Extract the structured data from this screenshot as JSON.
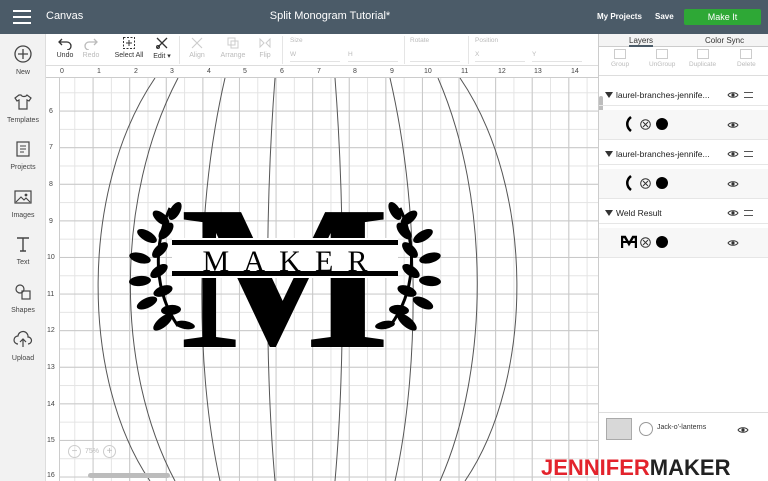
{
  "topbar": {
    "app_title": "Canvas",
    "doc_title": "Split Monogram Tutorial*",
    "projects": "My Projects",
    "save": "Save",
    "make_it": "Make It"
  },
  "sidebar": {
    "items": [
      {
        "label": "New",
        "icon": "plus-circle-icon"
      },
      {
        "label": "Templates",
        "icon": "shirt-icon"
      },
      {
        "label": "Projects",
        "icon": "projects-icon"
      },
      {
        "label": "Images",
        "icon": "image-icon"
      },
      {
        "label": "Text",
        "icon": "text-icon"
      },
      {
        "label": "Shapes",
        "icon": "shapes-icon"
      },
      {
        "label": "Upload",
        "icon": "upload-icon"
      }
    ]
  },
  "toolbar": {
    "undo": "Undo",
    "redo": "Redo",
    "select_all": "Select All",
    "edit": "Edit",
    "align": "Align",
    "arrange": "Arrange",
    "flip": "Flip",
    "size_label": "Size",
    "w": "W",
    "h": "H",
    "rotate_label": "Rotate",
    "position_label": "Position",
    "x": "X",
    "y": "Y"
  },
  "ruler": {
    "top": [
      "0",
      "1",
      "2",
      "3",
      "4",
      "5",
      "6",
      "7",
      "8",
      "9",
      "10",
      "11",
      "12",
      "13",
      "14"
    ],
    "left": [
      "6",
      "7",
      "8",
      "9",
      "10",
      "11",
      "12",
      "13",
      "14",
      "15",
      "16"
    ]
  },
  "canvas": {
    "zoom": "75%",
    "monogram_letter": "M",
    "monogram_word": "MAKER"
  },
  "panel": {
    "tabs": [
      "Layers",
      "Color Sync"
    ],
    "actions": [
      "Group",
      "UnGroup",
      "Duplicate",
      "Delete"
    ],
    "layers": [
      {
        "name": "laurel-branches-jennife..."
      },
      {
        "name": "laurel-branches-jennife..."
      },
      {
        "name": "Weld Result"
      }
    ],
    "blank_canvas": "Jack-o'-lanterns"
  },
  "brand": {
    "part1": "JENNIFER",
    "part2": "MAKER"
  },
  "colors": {
    "topbar": "#4b5b68",
    "make_it": "#2ea836",
    "brand_red": "#e3232c"
  }
}
